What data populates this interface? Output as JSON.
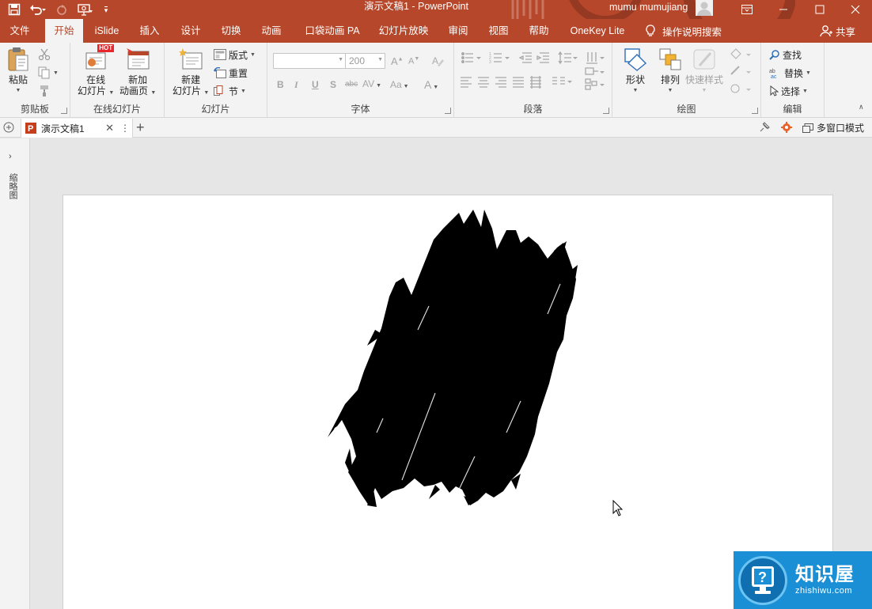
{
  "titlebar": {
    "doc_title": "演示文稿1  -  PowerPoint",
    "user_name": "mumu mumujiang",
    "qat_more": "▾"
  },
  "tabs": [
    {
      "label": "文件"
    },
    {
      "label": "开始"
    },
    {
      "label": "iSlide"
    },
    {
      "label": "插入"
    },
    {
      "label": "设计"
    },
    {
      "label": "切换"
    },
    {
      "label": "动画"
    },
    {
      "label": "口袋动画 PA"
    },
    {
      "label": "幻灯片放映"
    },
    {
      "label": "审阅"
    },
    {
      "label": "视图"
    },
    {
      "label": "帮助"
    },
    {
      "label": "OneKey Lite"
    }
  ],
  "tell_me": "操作说明搜索",
  "share": "共享",
  "ribbon": {
    "clipboard": {
      "label": "剪贴板",
      "paste": "粘贴"
    },
    "online_slides": {
      "label": "在线幻灯片",
      "online_l1": "在线",
      "online_l2": "幻灯片",
      "hot": "HOT",
      "anim_l1": "新加",
      "anim_l2": "动画页"
    },
    "slides": {
      "label": "幻灯片",
      "new_l1": "新建",
      "new_l2": "幻灯片",
      "layout": "版式",
      "reset": "重置",
      "section": "节"
    },
    "font": {
      "label": "字体",
      "font_name": "",
      "font_size": "200"
    },
    "paragraph": {
      "label": "段落"
    },
    "drawing": {
      "label": "绘图",
      "shapes": "形状",
      "arrange": "排列",
      "quick_styles": "快速样式"
    },
    "editing": {
      "label": "编辑",
      "find": "查找",
      "replace": "替换",
      "select": "选择"
    }
  },
  "doc_tab": {
    "name": "演示文稿1"
  },
  "multi_window": "多窗口模式",
  "left_pane": {
    "label": "缩略图"
  },
  "watermark": {
    "title": "知识屋",
    "url": "zhishiwu.com"
  },
  "colors": {
    "accent": "#b7472a",
    "ribbon_bg": "#f3f3f3",
    "workspace": "#e6e6e6"
  }
}
